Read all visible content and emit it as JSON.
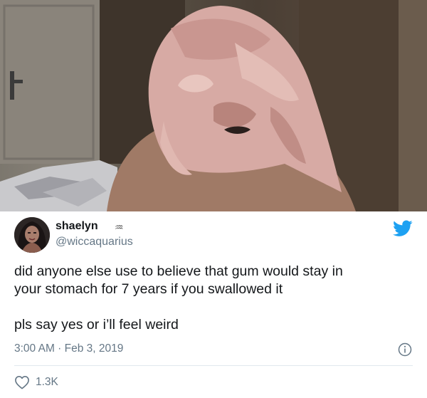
{
  "tweet": {
    "display_name": "shaelyn",
    "zodiac_icon": "aquarius-icon",
    "handle": "@wiccaquarius",
    "text_line1": "did anyone else use to believe that gum would stay in",
    "text_line2": "your stomach for 7 years if you swallowed it",
    "text_line3": "pls say yes or i’ll feel weird",
    "timestamp": "3:00 AM · Feb 3, 2019",
    "like_count": "1.3K",
    "icons": [
      "twitter-bird-icon",
      "info-icon",
      "heart-icon"
    ],
    "colors": {
      "accent": "#1da1f2",
      "secondary_text": "#657786",
      "divider": "#e1e8ed"
    }
  }
}
